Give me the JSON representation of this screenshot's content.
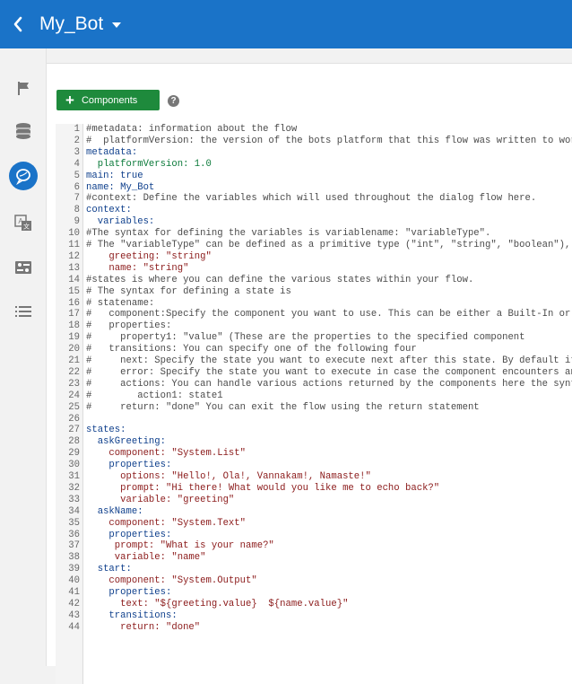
{
  "header": {
    "back_icon": "chevron-left-icon",
    "title": "My_Bot",
    "menu_icon": "caret-down-icon"
  },
  "sidebar": {
    "items": [
      {
        "name": "flag",
        "icon": "flag-icon"
      },
      {
        "name": "entities",
        "icon": "database-icon"
      },
      {
        "name": "flows",
        "icon": "chat-bubble-icon",
        "active": true
      },
      {
        "name": "translation",
        "icon": "translate-icon"
      },
      {
        "name": "settings",
        "icon": "toggle-settings-icon"
      },
      {
        "name": "list",
        "icon": "list-icon"
      }
    ]
  },
  "toolbar": {
    "components_label": "Components",
    "help_label": "?"
  },
  "colors": {
    "header": "#1a73c8",
    "button": "#1e8a3c"
  },
  "editor": {
    "lines": [
      {
        "n": "1",
        "t": "#metadata: information about the flow",
        "k": "comment"
      },
      {
        "n": "2",
        "t": "#  platformVersion: the version of the bots platform that this flow was written to work wi",
        "k": "comment"
      },
      {
        "n": "3",
        "t": "metadata:",
        "k": "key"
      },
      {
        "n": "4",
        "t": "  platformVersion: 1.0",
        "k": "num"
      },
      {
        "n": "5",
        "t": "main: true",
        "k": "key"
      },
      {
        "n": "6",
        "t": "name: My_Bot",
        "k": "key"
      },
      {
        "n": "7",
        "t": "#context: Define the variables which will used throughout the dialog flow here.",
        "k": "comment"
      },
      {
        "n": "8",
        "t": "context:",
        "k": "key"
      },
      {
        "n": "9",
        "t": "  variables:",
        "k": "key"
      },
      {
        "n": "10",
        "t": "#The syntax for defining the variables is variablename: \"variableType\".",
        "k": "comment"
      },
      {
        "n": "11",
        "t": "# The \"variableType\" can be defined as a primitive type (\"int\", \"string\", \"boolean\"), \"lis",
        "k": "comment"
      },
      {
        "n": "12",
        "t": "    greeting: \"string\"",
        "k": "str"
      },
      {
        "n": "13",
        "t": "    name: \"string\"",
        "k": "str"
      },
      {
        "n": "14",
        "t": "#states is where you can define the various states within your flow.",
        "k": "comment"
      },
      {
        "n": "15",
        "t": "# The syntax for defining a state is",
        "k": "comment"
      },
      {
        "n": "16",
        "t": "# statename:",
        "k": "comment"
      },
      {
        "n": "17",
        "t": "#   component:Specify the component you want to use. This can be either a Built-In or cust",
        "k": "comment"
      },
      {
        "n": "18",
        "t": "#   properties:",
        "k": "comment"
      },
      {
        "n": "19",
        "t": "#     property1: \"value\" (These are the properties to the specified component",
        "k": "comment"
      },
      {
        "n": "20",
        "t": "#   transitions: You can specify one of the following four",
        "k": "comment"
      },
      {
        "n": "21",
        "t": "#     next: Specify the state you want to execute next after this state. By default it wil",
        "k": "comment"
      },
      {
        "n": "22",
        "t": "#     error: Specify the state you want to execute in case the component encounters any er",
        "k": "comment"
      },
      {
        "n": "23",
        "t": "#     actions: You can handle various actions returned by the components here the syntax i",
        "k": "comment"
      },
      {
        "n": "24",
        "t": "#        action1: state1",
        "k": "comment"
      },
      {
        "n": "25",
        "t": "#     return: \"done\" You can exit the flow using the return statement",
        "k": "comment"
      },
      {
        "n": "26",
        "t": "",
        "k": "plain"
      },
      {
        "n": "27",
        "t": "states:",
        "k": "key"
      },
      {
        "n": "28",
        "t": "  askGreeting:",
        "k": "key"
      },
      {
        "n": "29",
        "t": "    component: \"System.List\"",
        "k": "str"
      },
      {
        "n": "30",
        "t": "    properties:",
        "k": "key"
      },
      {
        "n": "31",
        "t": "      options: \"Hello!, Ola!, Vannakam!, Namaste!\"",
        "k": "str"
      },
      {
        "n": "32",
        "t": "      prompt: \"Hi there! What would you like me to echo back?\"",
        "k": "str"
      },
      {
        "n": "33",
        "t": "      variable: \"greeting\"",
        "k": "str"
      },
      {
        "n": "34",
        "t": "  askName:",
        "k": "key"
      },
      {
        "n": "35",
        "t": "    component: \"System.Text\"",
        "k": "str"
      },
      {
        "n": "36",
        "t": "    properties:",
        "k": "key"
      },
      {
        "n": "37",
        "t": "     prompt: \"What is your name?\"",
        "k": "str"
      },
      {
        "n": "38",
        "t": "     variable: \"name\"",
        "k": "str"
      },
      {
        "n": "39",
        "t": "  start:",
        "k": "key"
      },
      {
        "n": "40",
        "t": "    component: \"System.Output\"",
        "k": "str"
      },
      {
        "n": "41",
        "t": "    properties:",
        "k": "key"
      },
      {
        "n": "42",
        "t": "      text: \"${greeting.value}  ${name.value}\"",
        "k": "str"
      },
      {
        "n": "43",
        "t": "    transitions:",
        "k": "key"
      },
      {
        "n": "44",
        "t": "      return: \"done\"",
        "k": "str"
      }
    ]
  }
}
